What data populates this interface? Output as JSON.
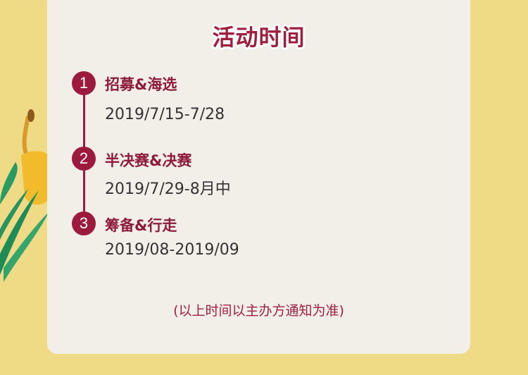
{
  "title": "活动时间",
  "steps": [
    {
      "num": "1",
      "label": "招募&海选",
      "date": "2019/7/15-7/28"
    },
    {
      "num": "2",
      "label": "半决赛&决赛",
      "date": "2019/7/29-8月中"
    },
    {
      "num": "3",
      "label": "筹备&行走",
      "date": "2019/08-2019/09"
    }
  ],
  "note": "(以上时间以主办方通知为准)",
  "colors": {
    "background": "#efdb86",
    "card": "#f2efe8",
    "accent": "#9c1a3b"
  }
}
